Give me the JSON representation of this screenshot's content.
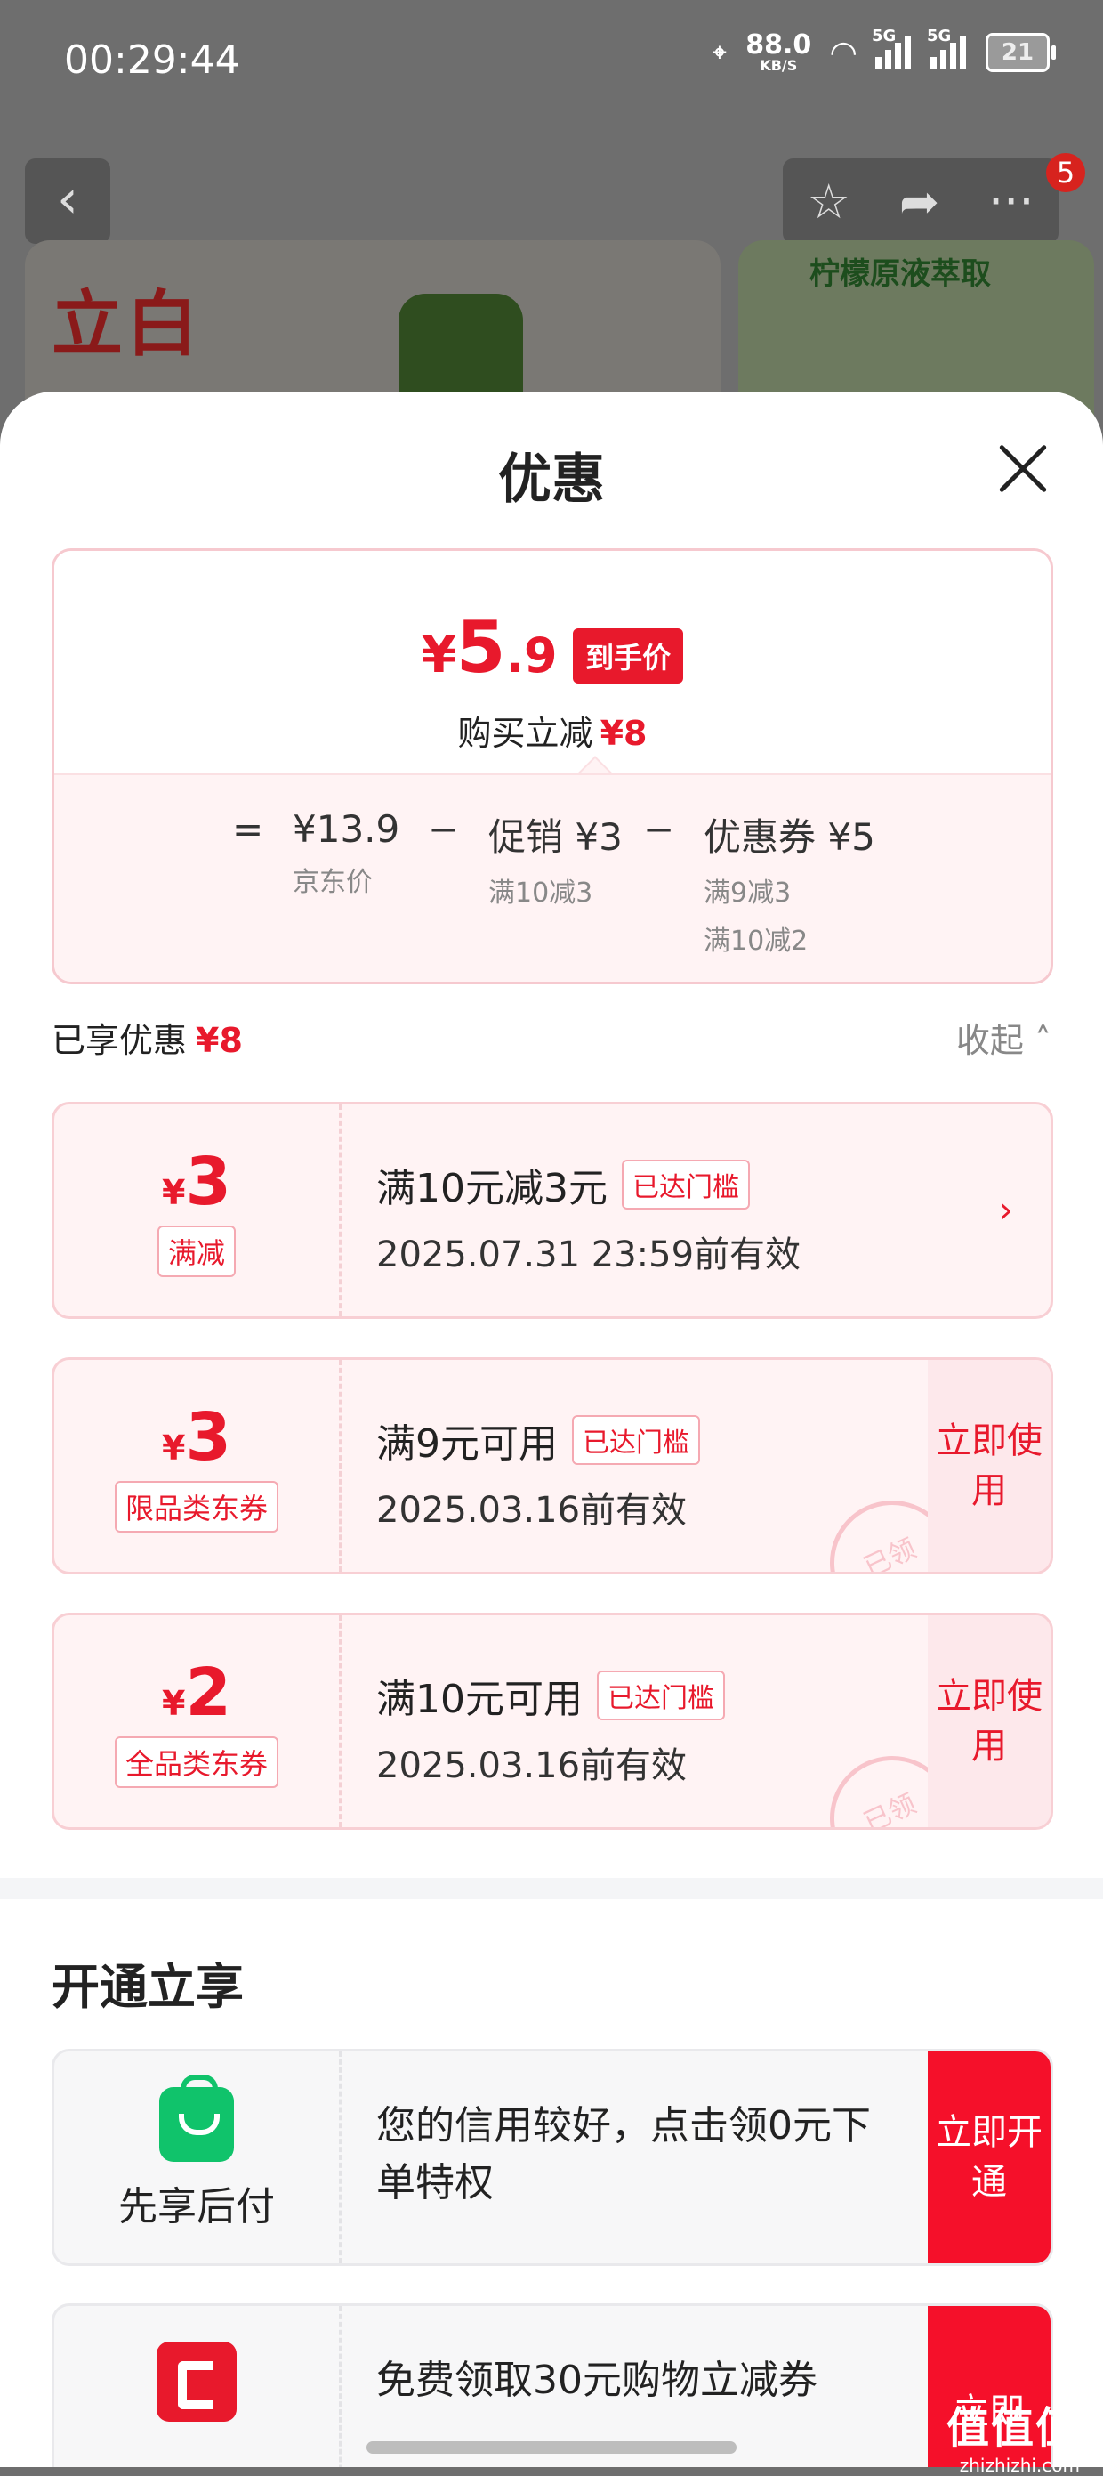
{
  "status_bar": {
    "time": "00:29:44",
    "net_speed": "88.0",
    "net_unit": "KB/S",
    "signal1": "5G",
    "signal2": "5G",
    "battery": "21"
  },
  "background_page": {
    "badge_count": "5",
    "brand_logo": "立白",
    "product2_title": "柠檬原液萃取"
  },
  "sheet": {
    "title": "优惠",
    "summary": {
      "yen": "¥",
      "price_int": "5",
      "price_dec": ".9",
      "price_tag": "到手价",
      "reduce_label": "购买立减",
      "reduce_value": "¥8",
      "eq": "=",
      "items": [
        {
          "value": "¥13.9",
          "sub": "京东价"
        },
        {
          "value": "促销 ¥3",
          "sub": "满10减3"
        },
        {
          "value": "优惠券 ¥5",
          "sub": "满9减3",
          "sub2": "满10减2"
        }
      ],
      "minus": "−"
    },
    "enjoyed": {
      "label": "已享优惠",
      "value": "¥8",
      "collapse": "收起"
    },
    "coupons": [
      {
        "yen": "¥",
        "amount": "3",
        "type": "满减",
        "condition": "满10元减3元",
        "met": "已达门槛",
        "valid": "2025.07.31 23:59前有效",
        "chevron": "›"
      },
      {
        "yen": "¥",
        "amount": "3",
        "type": "限品类东券",
        "condition": "满9元可用",
        "met": "已达门槛",
        "valid": "2025.03.16前有效",
        "action": "立即使用",
        "stamp": "已领"
      },
      {
        "yen": "¥",
        "amount": "2",
        "type": "全品类东券",
        "condition": "满10元可用",
        "met": "已达门槛",
        "valid": "2025.03.16前有效",
        "action": "立即使用",
        "stamp": "已领"
      }
    ],
    "open_section": {
      "title": "开通立享",
      "cards": [
        {
          "icon": "green-bag-icon",
          "label": "先享后付",
          "desc": "您的信用较好，点击领0元下单特权",
          "button": "立即开通"
        },
        {
          "icon": "red-card-icon",
          "label": "",
          "desc": "免费领取30元购物立减券",
          "button": "立即"
        }
      ]
    }
  },
  "watermark": {
    "text": "值值值",
    "domain": "zhizhizhi.com"
  },
  "colors": {
    "accent": "#e8192c",
    "green": "#10c36b"
  }
}
